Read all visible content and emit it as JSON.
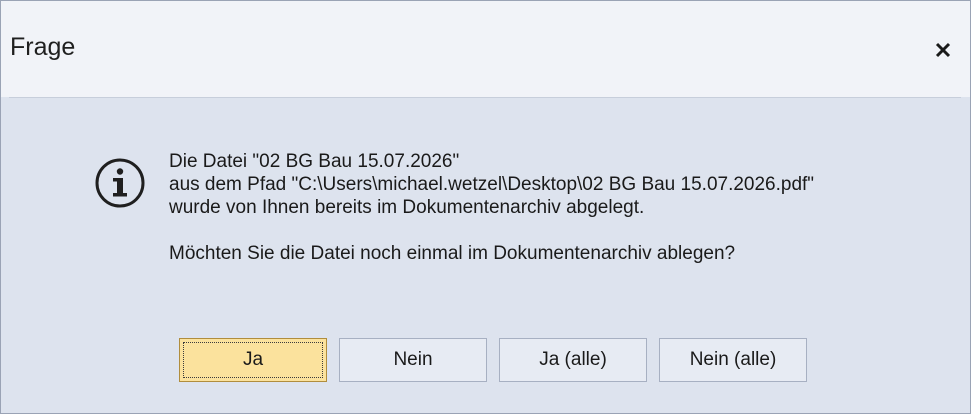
{
  "dialog": {
    "title": "Frage",
    "close_icon": "close-icon"
  },
  "message": {
    "icon": "info-icon",
    "line1": "Die Datei \"02 BG Bau 15.07.2026\"",
    "line2": "aus dem Pfad \"C:\\Users\\michael.wetzel\\Desktop\\02 BG Bau 15.07.2026.pdf\"",
    "line3": "wurde von Ihnen bereits im Dokumentenarchiv abgelegt.",
    "question": "Möchten Sie die Datei noch einmal im Dokumentenarchiv ablegen?"
  },
  "buttons": {
    "ja": "Ja",
    "nein": "Nein",
    "ja_alle": "Ja (alle)",
    "nein_alle": "Nein (alle)"
  },
  "colors": {
    "default_button": "#fbe29d",
    "background": "#dde3ee",
    "title_bar": "#f1f3f8"
  }
}
